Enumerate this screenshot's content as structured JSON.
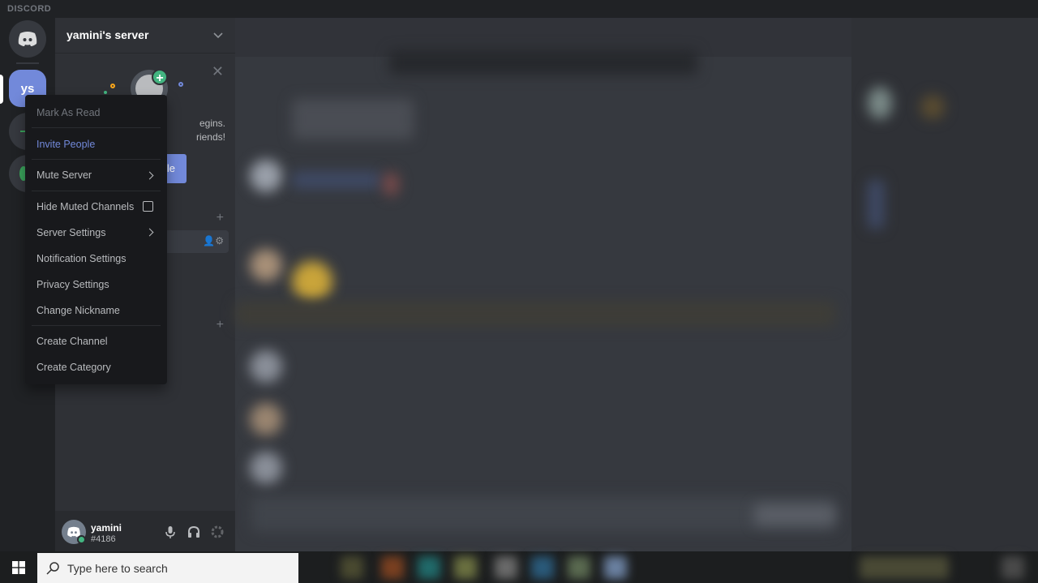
{
  "app": {
    "brand": "DISCORD"
  },
  "guilds": {
    "home_label": "Home",
    "selected_server_abbrev": "ys"
  },
  "sidebar": {
    "server_name": "yamini's server",
    "invite_card": {
      "text_line1": "egins.",
      "text_line2": "riends!",
      "button_label": "le"
    }
  },
  "context_menu": {
    "items": [
      {
        "label": "Mark As Read",
        "state": "disabled"
      },
      {
        "label": "Invite People",
        "state": "accent"
      },
      {
        "label": "Mute Server",
        "has_submenu": true
      },
      {
        "label": "Hide Muted Channels",
        "checkbox": false
      },
      {
        "label": "Server Settings",
        "has_submenu": true
      },
      {
        "label": "Notification Settings"
      },
      {
        "label": "Privacy Settings"
      },
      {
        "label": "Change Nickname"
      },
      {
        "label": "Create Channel"
      },
      {
        "label": "Create Category"
      }
    ]
  },
  "user_panel": {
    "username": "yamini",
    "tag": "#4186",
    "status": "online"
  },
  "taskbar": {
    "search_placeholder": "Type here to search"
  },
  "colors": {
    "accent": "#7289da",
    "online": "#43b581",
    "menu_bg": "#18191c"
  }
}
